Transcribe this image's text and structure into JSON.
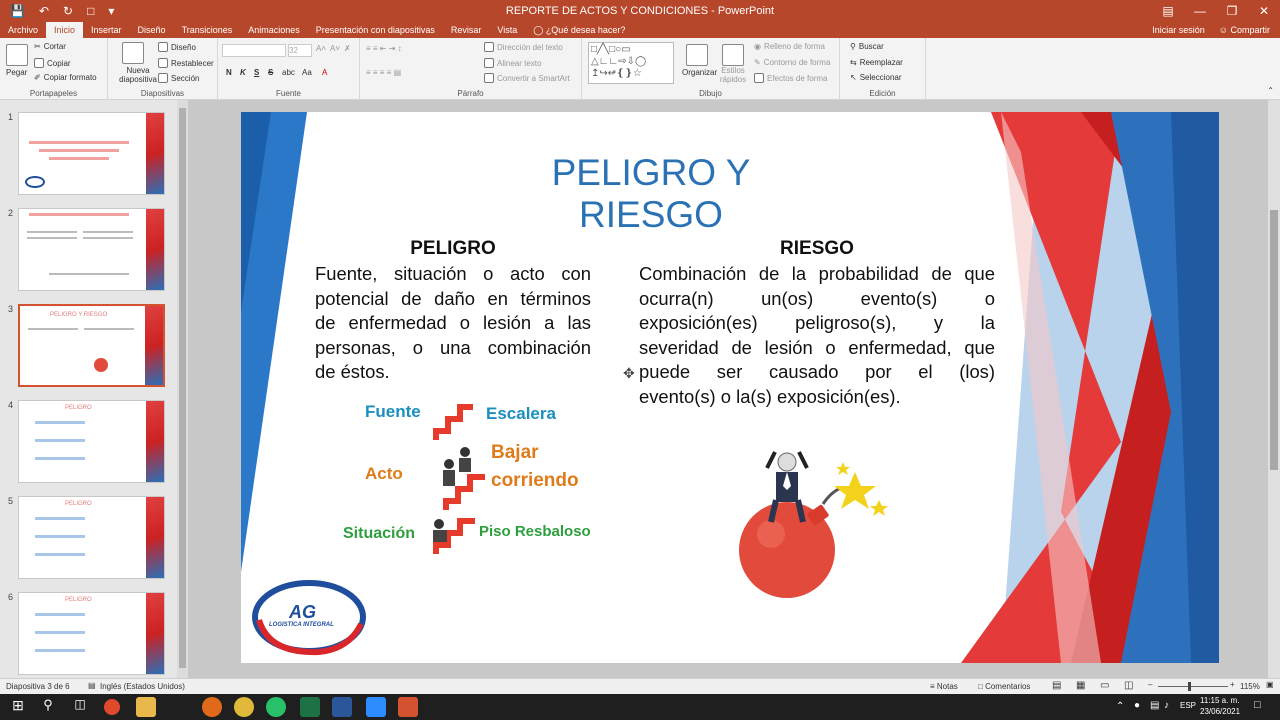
{
  "window": {
    "title": "REPORTE DE ACTOS Y CONDICIONES - PowerPoint"
  },
  "tabs": [
    "Archivo",
    "Inicio",
    "Insertar",
    "Diseño",
    "Transiciones",
    "Animaciones",
    "Presentación con diapositivas",
    "Revisar",
    "Vista"
  ],
  "tell_me": "¿Qué desea hacer?",
  "account": {
    "signin": "Iniciar sesión",
    "share": "Compartir"
  },
  "ribbon": {
    "clipboard": {
      "label": "Portapapeles",
      "paste": "Pegar",
      "cut": "Cortar",
      "copy": "Copiar",
      "format": "Copiar formato"
    },
    "slides": {
      "label": "Diapositivas",
      "new": "Nueva diapositiva",
      "layout": "Diseño",
      "reset": "Restablecer",
      "section": "Sección"
    },
    "font": {
      "label": "Fuente",
      "size": "32",
      "bold": "N",
      "italic": "K",
      "underline": "S",
      "strike": "S",
      "spacing": "abc",
      "aa": "Aa"
    },
    "paragraph": {
      "label": "Párrafo",
      "textdir": "Dirección del texto",
      "align": "Alinear texto",
      "smartart": "Convertir a SmartArt"
    },
    "drawing": {
      "label": "Dibujo",
      "arrange": "Organizar",
      "styles": "Estilos rápidos",
      "fill": "Relleno de forma",
      "outline": "Contorno de forma",
      "effects": "Efectos de forma"
    },
    "editing": {
      "label": "Edición",
      "find": "Buscar",
      "replace": "Reemplazar",
      "select": "Seleccionar"
    }
  },
  "thumbnails": [
    {
      "num": "1",
      "title": "REPORTE DE ACTOS Y CONDICIONES INSEGUROS"
    },
    {
      "num": "2",
      "title": "REPORTE DE ACTOS Y CONDICIONES INSEGUROS"
    },
    {
      "num": "3",
      "title": "PELIGRO Y RIESGO"
    },
    {
      "num": "4",
      "title": "PELIGRO"
    },
    {
      "num": "5",
      "title": "PELIGRO"
    },
    {
      "num": "6",
      "title": "PELIGRO"
    }
  ],
  "slide": {
    "title": "PELIGRO Y RIESGO",
    "peligro_heading": "PELIGRO",
    "peligro_lines": [
      "Fuente, situación o acto con",
      "potencial de daño en términos",
      "de enfermedad o lesión a las",
      "personas, o una combinación",
      "de éstos."
    ],
    "riesgo_heading": "RIESGO",
    "riesgo_lines": [
      "Combinación de la probabilidad de que",
      "ocurra(n) un(os) evento(s) o",
      "exposición(es) peligroso(s), y la",
      "severidad de lesión o enfermedad, que",
      "puede ser causado por el (los)",
      "evento(s) o la(s) exposición(es)."
    ],
    "diagram": {
      "fuente": "Fuente",
      "escalera": "Escalera",
      "acto": "Acto",
      "bajar1": "Bajar",
      "bajar2": "corriendo",
      "situacion": "Situación",
      "piso": "Piso Resbaloso"
    },
    "logo": {
      "ag": "AG",
      "sub": "LOGISTICA INTEGRAL"
    }
  },
  "status": {
    "slide": "Diapositiva 3 de 6",
    "lang": "Inglés (Estados Unidos)",
    "notes": "Notas",
    "comments": "Comentarios",
    "zoom": "115%"
  },
  "clock": {
    "time": "11:15 a. m.",
    "date": "23/06/2021",
    "lang": "ESP"
  },
  "colors": {
    "accent": "#b7472a",
    "title_blue": "#2b72b5",
    "green": "#2e9e3e",
    "orange": "#e07b1a",
    "teal": "#1a8fc0"
  }
}
